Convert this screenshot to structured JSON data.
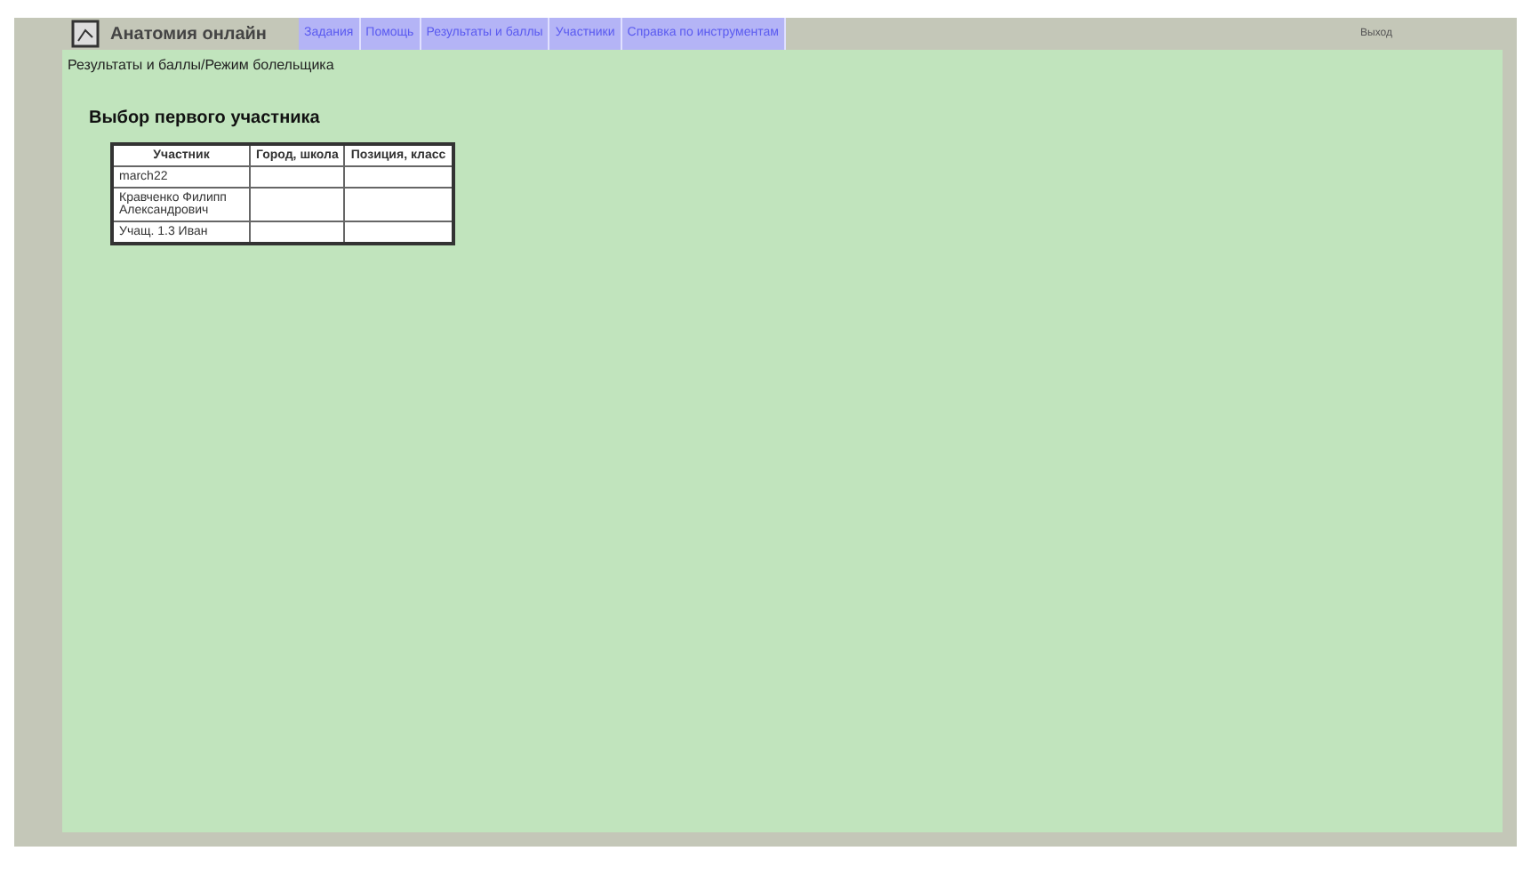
{
  "header": {
    "title": "Анатомия онлайн",
    "user": "Выход"
  },
  "nav_tabs": [
    {
      "label": "Задания"
    },
    {
      "label": "Помощь"
    },
    {
      "label": "Результаты и баллы"
    },
    {
      "label": "Участники"
    },
    {
      "label": "Справка по инструментам"
    }
  ],
  "breadcrumb": "Результаты и баллы/Режим болельщика",
  "heading": "Выбор первого участника",
  "table": {
    "columns": [
      "Участник",
      "Город, школа",
      "Позиция, класс"
    ],
    "rows": [
      [
        "march22",
        "",
        ""
      ],
      [
        "Кравченко Филипп Александрович",
        "",
        ""
      ],
      [
        "Учащ. 1.3 Иван",
        "",
        ""
      ]
    ]
  }
}
